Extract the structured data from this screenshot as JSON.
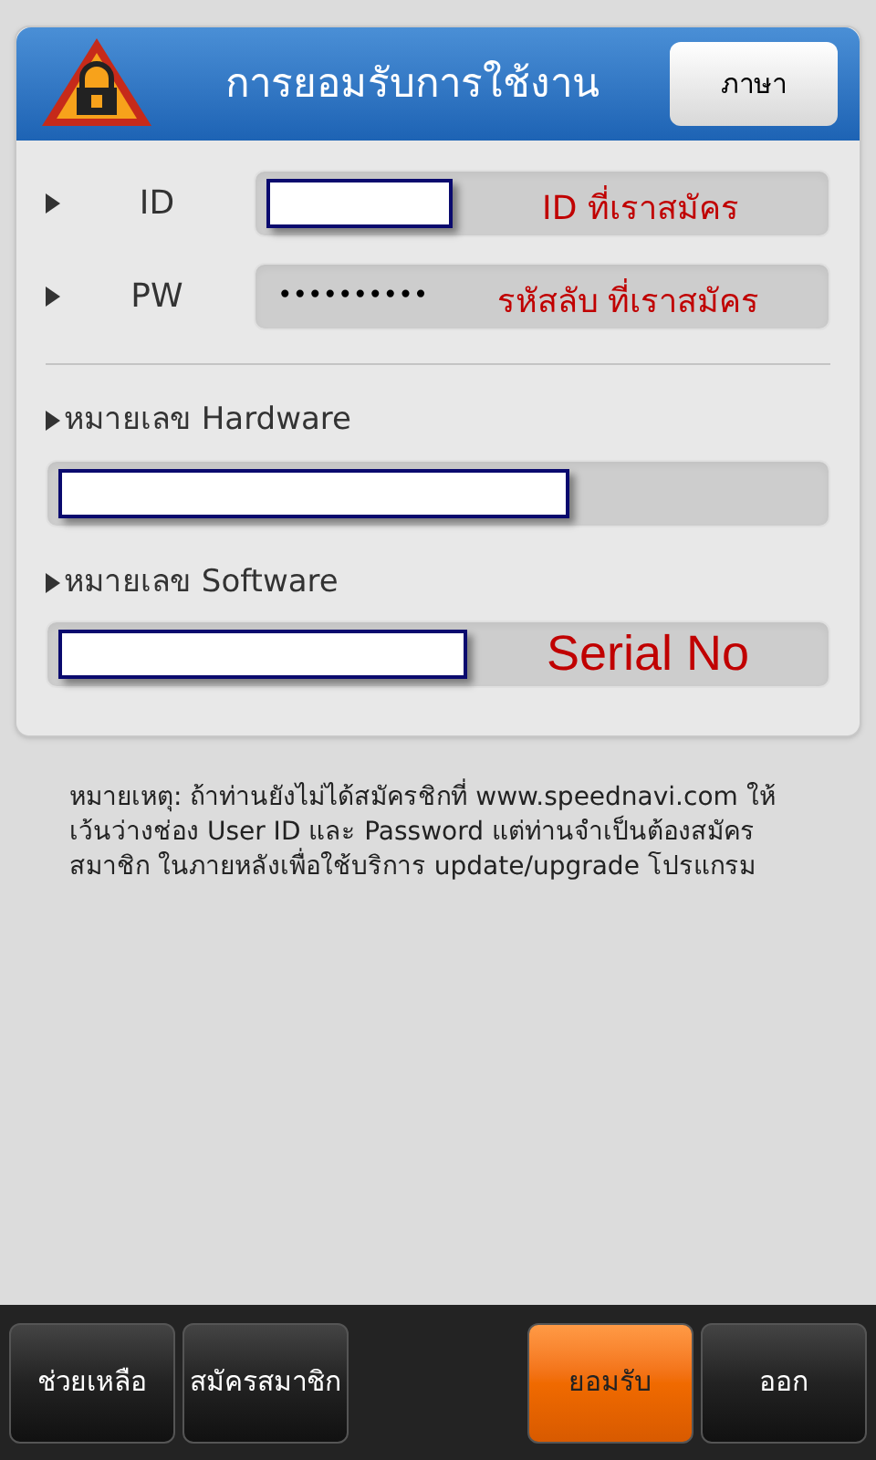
{
  "header": {
    "title": "การยอมรับการใช้งาน",
    "language_button": "ภาษา"
  },
  "credentials": [
    {
      "label": "ID",
      "kind": "redacted",
      "note": "ID ที่เราสมัคร"
    },
    {
      "label": "PW",
      "kind": "password",
      "value": "••••••••••",
      "note": "รหัสลับ ที่เราสมัคร"
    }
  ],
  "numbers": [
    {
      "label": "หมายเลข Hardware",
      "kind": "redacted"
    },
    {
      "label": "หมายเลข Software",
      "kind": "redacted",
      "note": "Serial No"
    }
  ],
  "remark": "หมายเหตุ: ถ้าท่านยังไม่ได้สมัครชิกที่ www.speednavi.com ให้เว้นว่างช่อง User ID และ Password แต่ท่านจำเป็นต้องสมัครสมาชิก ในภายหลังเพื่อใช้บริการ update/upgrade โปรแกรม",
  "left_buttons": [
    {
      "label": "ช่วยเหลือ",
      "kind": "dark"
    },
    {
      "label": "สมัครสมาชิก",
      "kind": "dark"
    }
  ],
  "right_buttons": [
    {
      "label": "ยอมรับ",
      "kind": "primary"
    },
    {
      "label": "ออก",
      "kind": "dark"
    }
  ]
}
